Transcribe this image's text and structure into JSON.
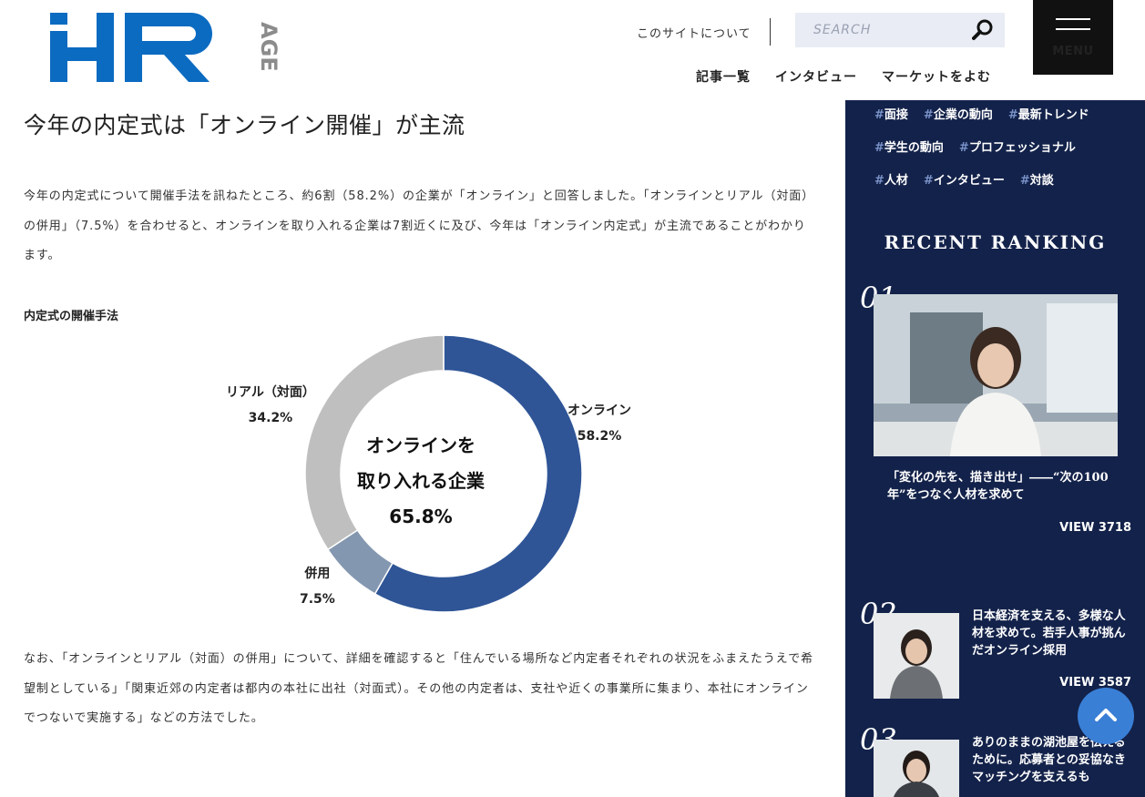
{
  "header": {
    "logo_text": "HR AGE",
    "about_link": "このサイトについて",
    "search_placeholder": "SEARCH",
    "menu_label": "MENU",
    "nav": [
      "記事一覧",
      "インタビュー",
      "マーケットをよむ"
    ]
  },
  "article": {
    "title": "今年の内定式は「オンライン開催」が主流",
    "paragraph1": "今年の内定式について開催手法を訊ねたところ、約6割（58.2%）の企業が「オンライン」と回答しました。「オンラインとリアル（対面）の併用」（7.5%）を合わせると、オンラインを取り入れる企業は7割近くに及び、今年は「オンライン内定式」が主流であることがわかります。",
    "chart_title": "内定式の開催手法",
    "paragraph2": "なお、「オンラインとリアル（対面）の併用」について、詳細を確認すると「住んでいる場所など内定者それぞれの状況をふまえたうえで希望制としている」「関東近郊の内定者は都内の本社に出社（対面式）。その他の内定者は、支社や近くの事業所に集まり、本社にオンラインでつないで実施する」などの方法でした。"
  },
  "chart_data": {
    "type": "pie",
    "categories": [
      "オンライン",
      "併用",
      "リアル（対面）"
    ],
    "values": [
      58.2,
      7.5,
      34.2
    ],
    "value_labels": [
      "58.2%",
      "7.5%",
      "34.2%"
    ],
    "colors": [
      "#2f5597",
      "#8497b0",
      "#bfbfbf"
    ],
    "center_label": [
      "オンラインを",
      "取り入れる企業",
      "65.8%"
    ]
  },
  "sidebar": {
    "tag_rows": [
      [
        "面接",
        "企業の動向",
        "最新トレンド"
      ],
      [
        "学生の動向",
        "プロフェッショナル"
      ],
      [
        "人材",
        "インタビュー",
        "対談"
      ]
    ],
    "hash": "#",
    "ranking_title": "RECENT RANKING",
    "ranking": [
      {
        "num": "01",
        "title": "「変化の先を、描き出せ」――“次の100年”をつなぐ人材を求めて",
        "views": "VIEW 3718"
      },
      {
        "num": "02",
        "title": "日本経済を支える、多様な人材を求めて。若手人事が挑んだオンライン採用",
        "views": "VIEW 3587"
      },
      {
        "num": "03",
        "title": "ありのままの湖池屋を伝えるために。応募者との妥協なきマッチングを支えるも",
        "views": ""
      }
    ]
  }
}
